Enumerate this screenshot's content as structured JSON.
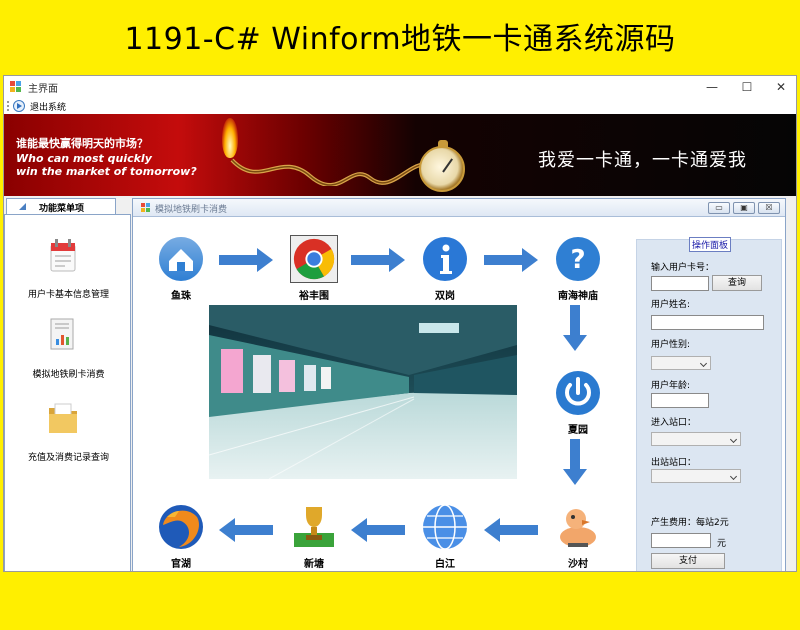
{
  "page_heading": "1191-C# Winform地铁一卡通系统源码",
  "main_window": {
    "title": "主界面",
    "controls": {
      "minimize": "—",
      "maximize": "☐",
      "close": "✕"
    },
    "menu": {
      "exit_label": "退出系统"
    }
  },
  "ad_banner": {
    "line1": "谁能最快赢得明天的市场？",
    "line2": "Who can most quickly",
    "line3": "win the market of tomorrow?",
    "slogan": "我爱一卡通，一卡通爱我"
  },
  "left_panel": {
    "tab_label": "功能菜单项",
    "items": [
      {
        "label": "用户卡基本信息管理",
        "icon": "card-manage-icon"
      },
      {
        "label": "模拟地铁刷卡消费",
        "icon": "report-icon"
      },
      {
        "label": "充值及消费记录查询",
        "icon": "folder-icon"
      }
    ]
  },
  "child_window": {
    "title": "模拟地铁刷卡消费",
    "controls": {
      "minimize": "▭",
      "maximize": "▣",
      "close": "☒"
    }
  },
  "stations": [
    {
      "name": "鱼珠",
      "icon": "home-icon"
    },
    {
      "name": "裕丰围",
      "icon": "chrome-icon"
    },
    {
      "name": "双岗",
      "icon": "info-icon"
    },
    {
      "name": "南海神庙",
      "icon": "help-icon"
    },
    {
      "name": "夏园",
      "icon": "power-icon"
    },
    {
      "name": "沙村",
      "icon": "rubber-duck-icon"
    },
    {
      "name": "白江",
      "icon": "globe-icon"
    },
    {
      "name": "新塘",
      "icon": "trophy-icon"
    },
    {
      "name": "官湖",
      "icon": "firefox-icon"
    }
  ],
  "op_panel": {
    "title": "操作面板",
    "card_label": "输入用户卡号：",
    "card_value": "",
    "query_button": "查询",
    "name_label": "用户姓名:",
    "name_value": "",
    "gender_label": "用户性别:",
    "age_label": "用户年龄:",
    "age_value": "",
    "entry_label": "进入站口：",
    "exit_label": "出站站口：",
    "fee_label": "产生费用：每站2元",
    "fee_value": "",
    "unit": "元",
    "pay_button": "支付"
  },
  "colors": {
    "page_background": "#ffef00",
    "panel_blue": "#dce6f2",
    "arrow_blue": "#3d7fcf"
  }
}
